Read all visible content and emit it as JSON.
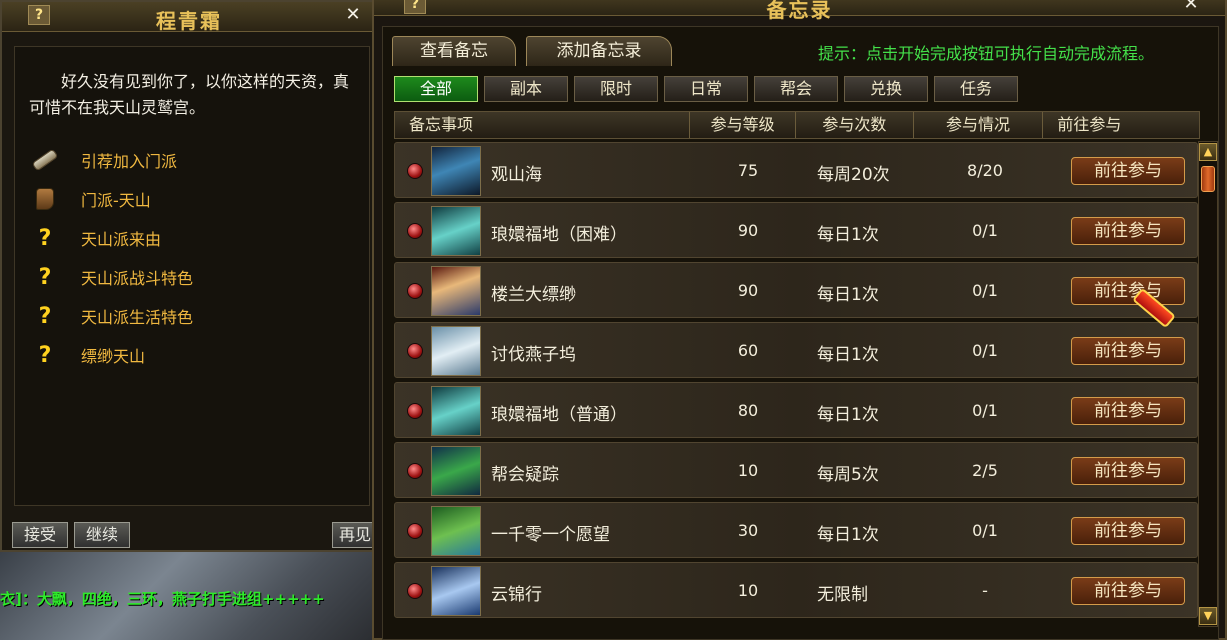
{
  "npc_dialog": {
    "title": "程青霜",
    "help": "?",
    "close": "✕",
    "greeting": "好久没有见到你了，以你这样的天资，真可惜不在我天山灵鹫宫。",
    "options": [
      {
        "icon": "scroll-icon",
        "label": "引荐加入门派"
      },
      {
        "icon": "boot-icon",
        "label": "门派-天山"
      },
      {
        "icon": "question-icon",
        "label": "天山派来由"
      },
      {
        "icon": "question-icon",
        "label": "天山派战斗特色"
      },
      {
        "icon": "question-icon",
        "label": "天山派生活特色"
      },
      {
        "icon": "question-icon",
        "label": "缥缈天山"
      }
    ],
    "buttons": {
      "accept": "接受",
      "continue": "继续",
      "goodbye": "再见"
    }
  },
  "chat": {
    "text": "衣]：大飘，四绝，三环，燕子打手进组+++++"
  },
  "memo": {
    "title": "备忘录",
    "help": "?",
    "close": "✕",
    "top_tabs": [
      "查看备忘",
      "添加备忘录"
    ],
    "hint": "提示：点击开始完成按钮可执行自动完成流程。",
    "filter_tabs": [
      "全部",
      "副本",
      "限时",
      "日常",
      "帮会",
      "兑换",
      "任务"
    ],
    "active_filter": "全部",
    "columns": [
      "备忘事项",
      "参与等级",
      "参与次数",
      "参与情况",
      "前往参与"
    ],
    "rows": [
      {
        "name": "观山海",
        "level": "75",
        "times": "每周20次",
        "status": "8/20",
        "action": "前往参与"
      },
      {
        "name": "琅嬛福地（困难）",
        "level": "90",
        "times": "每日1次",
        "status": "0/1",
        "action": "前往参与"
      },
      {
        "name": "楼兰大缥缈",
        "level": "90",
        "times": "每日1次",
        "status": "0/1",
        "action": "前往参与"
      },
      {
        "name": "讨伐燕子坞",
        "level": "60",
        "times": "每日1次",
        "status": "0/1",
        "action": "前往参与"
      },
      {
        "name": "琅嬛福地（普通）",
        "level": "80",
        "times": "每日1次",
        "status": "0/1",
        "action": "前往参与"
      },
      {
        "name": "帮会疑踪",
        "level": "10",
        "times": "每周5次",
        "status": "2/5",
        "action": "前往参与"
      },
      {
        "name": "一千零一个愿望",
        "level": "30",
        "times": "每日1次",
        "status": "0/1",
        "action": "前往参与"
      },
      {
        "name": "云锦行",
        "level": "10",
        "times": "无限制",
        "status": "-",
        "action": "前往参与"
      }
    ],
    "scroll_up": "▲",
    "scroll_down": "▼"
  }
}
